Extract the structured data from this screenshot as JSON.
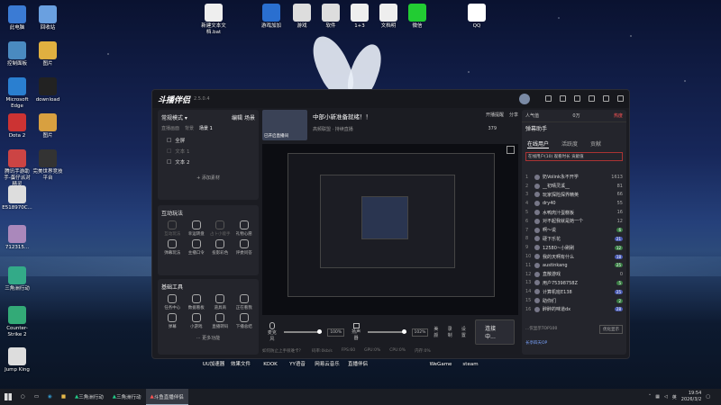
{
  "desktop": {
    "icons_left": [
      "此电脑",
      "回收站",
      "控制面板",
      "图片",
      "Microsoft Edge",
      "download",
      "Dota 2",
      "图片",
      "腾讯手游助手-蛋仔派对精灵",
      "完美世界竞技平台",
      "E518970C...",
      "712315...",
      "三角洲行动",
      "Counter-Strike 2",
      "Jump King"
    ],
    "icons_top": [
      "新建文本文档.bat",
      "游戏加加",
      "游戏",
      "软件",
      "1+3",
      "文档明",
      "微信",
      "QQ"
    ],
    "icons_bottom": [
      "UU加速器",
      "效果文件",
      "KOOK",
      "YY语音",
      "网易云音乐",
      "直播伴侣",
      "WeGame",
      "steam"
    ]
  },
  "window": {
    "brand": "斗播伴侣",
    "version": "2.5.0.4",
    "left": {
      "mode_label": "常规模式 ▾",
      "edit": "编辑",
      "check": "场景",
      "sub_tabs": [
        "直播画面",
        "背景",
        "场景 1"
      ],
      "scene_items": [
        "全屏",
        "文本 1",
        "文本 2"
      ],
      "add_material": "+ 添加素材",
      "interactive_title": "互动玩法",
      "interactive_tools": [
        "互动玩法",
        "幸运转盘",
        "占卜小能手",
        "礼物心愿",
        "弹幕玩法",
        "主播口令",
        "投影彩色",
        "评委问答"
      ],
      "basic_title": "基础工具",
      "basic_tools": [
        "任务中心",
        "数据看板",
        "道具商",
        "正在看我",
        "弹幕",
        "小游戏",
        "直播转码",
        "下播总结"
      ],
      "more": "··· 更多功能"
    },
    "center": {
      "stream_title": "中部小新准备就绪！！",
      "live_room": "已开启直播间",
      "category": "高频联盟 · 持续直播",
      "preview_counter": "379",
      "open_broadcast": "开播提醒",
      "share": "分享",
      "capture_label": "屏幕共享",
      "mic_label": "麦克风",
      "mic_pct": "100%",
      "speaker_label": "扬声器",
      "speaker_pct": "102%",
      "beauty": "美颜",
      "record": "录制",
      "settings": "设置",
      "go_live": "连接中...",
      "status_bar": [
        "如何防止上手很难卡？",
        "码率:0kb/s",
        "FPS:60",
        "GPU:0%",
        "CPU:0%",
        "内存:0%"
      ]
    },
    "right": {
      "title": "弹幕助手",
      "hot_label": "人气值",
      "hot_value": "0万",
      "heat": "热度",
      "tabs": [
        "在线用户",
        "活跃度",
        "贡献"
      ],
      "filter": "在线用户(10)  观看时长  贡献值",
      "list": [
        {
          "rank": "1",
          "name": "奶Volink永不开学",
          "score": "1613"
        },
        {
          "rank": "2",
          "name": "__初晴灵溪__",
          "score": "81"
        },
        {
          "rank": "3",
          "name": "玩家探险探界精英",
          "score": "66"
        },
        {
          "rank": "4",
          "name": "dry40",
          "score": "55"
        },
        {
          "rank": "5",
          "name": "水鸭肉汁蛋糕板",
          "score": "16"
        },
        {
          "rank": "6",
          "name": "对不起我就是她一个",
          "score": "12"
        },
        {
          "rank": "7",
          "name": "啊～说",
          "badge": "6"
        },
        {
          "rank": "8",
          "name": "硬下乐花",
          "badge": "21"
        },
        {
          "rank": "9",
          "name": "12580~小刷刷",
          "badge": "12"
        },
        {
          "rank": "10",
          "name": "我的天啊有什么",
          "badge": "18"
        },
        {
          "rank": "11",
          "name": "austinkang",
          "badge": "25"
        },
        {
          "rank": "12",
          "name": "直散游戏",
          "score": "0"
        },
        {
          "rank": "13",
          "name": "用户75398758Z",
          "badge": "5"
        },
        {
          "rank": "14",
          "name": "计算机班E138",
          "badge": "25"
        },
        {
          "rank": "15",
          "name": "助你们",
          "badge": "2"
        },
        {
          "rank": "16",
          "name": "醉醉的味道dx",
          "badge": "28"
        }
      ],
      "bottom_link": "...仅显示TOP100",
      "toggle": "优化显示",
      "footer": "长亭四天OP"
    }
  },
  "taskbar": {
    "items": [
      "三角洲行动",
      "三角洲行动",
      "斗鱼直播伴侣"
    ],
    "ime": "英",
    "time": "19:54",
    "date": "2026/3/2"
  }
}
